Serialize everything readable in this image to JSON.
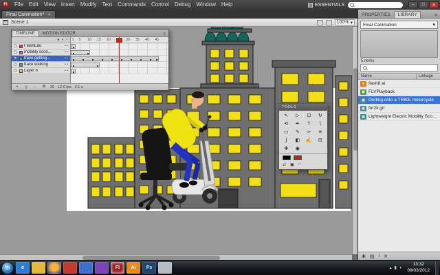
{
  "menu_bar": {
    "app_icon": "Fl",
    "items": [
      "File",
      "Edit",
      "View",
      "Insert",
      "Modify",
      "Text",
      "Commands",
      "Control",
      "Debug",
      "Window",
      "Help"
    ],
    "workspace": "ESSENTIALS"
  },
  "window_controls": {
    "minimize": "–",
    "restore": "□",
    "close": "✕"
  },
  "document_tab": {
    "title": "Final Canimation*",
    "close": "✕"
  },
  "edit_bar": {
    "scene": "Scene 1",
    "zoom": "100%"
  },
  "timeline": {
    "tab_timeline": "TIMELINE",
    "tab_motion_editor": "MOTION EDITOR",
    "header_icons": {
      "visibility": "●",
      "lock": "▪",
      "outline": "▫"
    },
    "layers": [
      {
        "name": "FlashEdu",
        "color": "#d94c42"
      },
      {
        "name": "mobility scoo...",
        "color": "#cf52c7"
      },
      {
        "name": "trace getting...",
        "color": "#52b24d",
        "selected": true
      },
      {
        "name": "trace walking",
        "color": "#4d9fd9"
      },
      {
        "name": "Layer 6",
        "color": "#d9cf4d"
      }
    ],
    "frame_numbers": [
      "1",
      "5",
      "10",
      "15",
      "20",
      "25",
      "30",
      "35",
      "40",
      "45"
    ],
    "status": {
      "current_frame": "26",
      "fps": "12.0 fps",
      "elapsed": "2.1 s"
    },
    "status_icons": [
      "⌖",
      "◎",
      "◌",
      "⧉"
    ]
  },
  "tools": {
    "title": "TOOLS",
    "items": [
      {
        "name": "selection",
        "glyph": "↖"
      },
      {
        "name": "subselection",
        "glyph": "▷"
      },
      {
        "name": "free-transform",
        "glyph": "⊡"
      },
      {
        "name": "3d-rotation",
        "glyph": "↻"
      },
      {
        "name": "lasso",
        "glyph": "⟲"
      },
      {
        "name": "pen",
        "glyph": "✒"
      },
      {
        "name": "text",
        "glyph": "T"
      },
      {
        "name": "line",
        "glyph": "∖"
      },
      {
        "name": "rectangle",
        "glyph": "▭"
      },
      {
        "name": "pencil",
        "glyph": "✎"
      },
      {
        "name": "brush",
        "glyph": "✑"
      },
      {
        "name": "deco",
        "glyph": "✳"
      },
      {
        "name": "bone",
        "glyph": "ʃ"
      },
      {
        "name": "paint-bucket",
        "glyph": "◧"
      },
      {
        "name": "eyedropper",
        "glyph": "✍"
      },
      {
        "name": "eraser",
        "glyph": "⊟"
      },
      {
        "name": "hand",
        "glyph": "✥"
      },
      {
        "name": "zoom",
        "glyph": "◉"
      }
    ],
    "stroke_color": "#000000",
    "fill_color": "#c02020",
    "options": {
      "swap": "⇄",
      "default": "▣",
      "snap": "∩"
    }
  },
  "stage": {
    "palette": {
      "pasteboard_gray": "#9a9a9a",
      "stage_white": "#ffffff",
      "building_gray": "#6e6e6e",
      "window_yellow": "#f2df17",
      "dome_teal": "#17655a",
      "shirt_yellow": "#efe312",
      "pants_blue": "#2531c0"
    }
  },
  "library": {
    "tab_properties": "PROPERTIES",
    "tab_library": "LIBRARY",
    "panel_menu": "≡",
    "document_name": "Final Canimation",
    "items_count": "5 items",
    "columns": {
      "name": "Name",
      "linkage": "Linkage"
    },
    "items": [
      {
        "name": "flash8.ai",
        "linkage": ""
      },
      {
        "name": "FLVPlayback",
        "linkage": ""
      },
      {
        "name": "Getting onto a TRIKE motorcycle",
        "linkage": ""
      },
      {
        "name": "for2k.gif",
        "linkage": ""
      },
      {
        "name": "Lightweight Electric Mobility Scoot...",
        "linkage": ""
      }
    ],
    "footer_icons": {
      "new_symbol": "✚",
      "new_folder": "▤",
      "properties": "i",
      "delete": "✕"
    }
  },
  "taskbar": {
    "start_glyph": "⊞",
    "icons": [
      {
        "name": "internet-explorer",
        "label": "e",
        "color": "#2f7cd4"
      },
      {
        "name": "windows-explorer",
        "label": "",
        "color": "#e3b93c"
      },
      {
        "name": "firefox",
        "label": "",
        "color": "#e8701f"
      },
      {
        "name": "media-app",
        "label": "",
        "color": "#c23b2e"
      },
      {
        "name": "messenger-app",
        "label": "",
        "color": "#3f6fd1"
      },
      {
        "name": "purple-app",
        "label": "",
        "color": "#7a44b4"
      },
      {
        "name": "flash",
        "label": "Fl",
        "color": "#9b1c20",
        "active": true
      },
      {
        "name": "illustrator",
        "label": "Ai",
        "color": "#e58a1e"
      },
      {
        "name": "photoshop",
        "label": "Ps",
        "color": "#20456e"
      },
      {
        "name": "notepad",
        "label": "",
        "color": "#b7bcc2"
      }
    ],
    "tray_icons": [
      "▴",
      "▮",
      "◗"
    ],
    "clock_time": "13:32",
    "clock_date": "09/03/2012"
  }
}
